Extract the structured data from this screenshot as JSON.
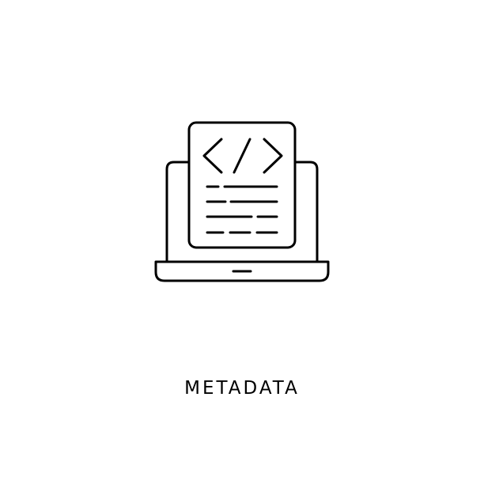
{
  "caption": {
    "text": "METADATA"
  },
  "icon": {
    "name": "laptop-code-document-icon",
    "code_symbol": "</>",
    "stroke_color": "#000000"
  },
  "colors": {
    "background": "#ffffff",
    "foreground": "#000000"
  }
}
